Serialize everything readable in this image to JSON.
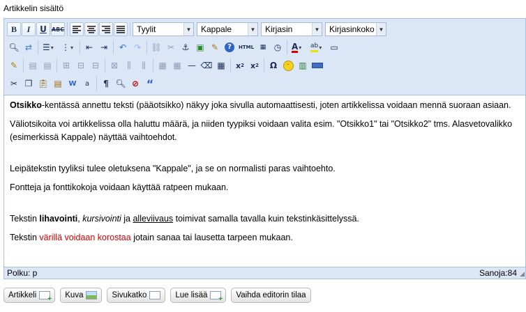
{
  "field_label": "Artikkelin sisältö",
  "toolbar": {
    "row1": {
      "buttons": [
        {
          "name": "bold-icon",
          "glyph": "B"
        },
        {
          "name": "italic-icon",
          "glyph": "I"
        },
        {
          "name": "underline-icon",
          "glyph": "U"
        },
        {
          "name": "strikethrough-icon",
          "glyph": "ABC"
        },
        {
          "name": "align-left-icon",
          "glyph": "≡"
        },
        {
          "name": "align-center-icon",
          "glyph": "≡"
        },
        {
          "name": "align-right-icon",
          "glyph": "≡"
        },
        {
          "name": "align-justify-icon",
          "glyph": "≡"
        }
      ],
      "dropdowns": {
        "styles": "Tyylit",
        "paragraph": "Kappale",
        "font": "Kirjasin",
        "font_size": "Kirjasinkoko"
      }
    },
    "row2_icons": [
      "find-icon",
      "replace-icon",
      "bullet-list-icon",
      "numbered-list-icon",
      "outdent-icon",
      "indent-icon",
      "undo-icon",
      "redo-icon",
      "link-icon",
      "unlink-icon",
      "anchor-icon",
      "image-icon",
      "cleanup-icon",
      "help-icon",
      "html-icon",
      "insert-date-icon",
      "insert-time-icon",
      "font-color-icon",
      "highlight-color-icon",
      "fullscreen-icon"
    ],
    "row3_icons": [
      "insert-table-icon",
      "table-props-icon",
      "cell-props-icon",
      "row-props-icon",
      "insert-row-before-icon",
      "insert-row-after-icon",
      "delete-row-icon",
      "col-before-icon",
      "col-after-icon",
      "delete-col-icon",
      "split-cells-icon",
      "merge-cells-icon",
      "horizontal-rule-icon",
      "eraser-icon",
      "visual-aid-icon",
      "subscript-icon",
      "superscript-icon",
      "special-char-icon",
      "emoticon-icon",
      "media-icon",
      "hr-advanced-icon"
    ],
    "row4_icons": [
      "cut-icon",
      "copy-icon",
      "paste-icon",
      "paste-text-icon",
      "paste-word-icon",
      "select-all-icon",
      "show-blocks-icon",
      "preview-icon",
      "remove-format-icon",
      "blockquote-icon"
    ]
  },
  "content": {
    "p1": {
      "bold": "Otsikko",
      "rest": "-kentässä annettu teksti (pääotsikko) näkyy joka sivulla automaattisesti, joten artikkelissa voidaan mennä suoraan asiaan."
    },
    "p2": "Väliotsikoita voi artikkelissa olla haluttu määrä, ja niiden tyypiksi voidaan valita esim. \"Otsikko1\" tai \"Otsikko2\" tms. Alasvetovalikko (esimerkissä Kappale) näyttää vaihtoehdot.",
    "p3": "Leipätekstin tyyliksi tulee oletuksena \"Kappale\", ja se on normalisti paras vaihtoehto.",
    "p4": "Fontteja ja fonttikokoja voidaan käyttää ratpeen mukaan.",
    "p5": {
      "start": "Tekstin ",
      "bold": "lihavointi",
      "comma": ", ",
      "italic": "kursivointi",
      "ja": " ja ",
      "underline": "alleviivaus",
      "end": " toimivat samalla tavalla kuin tekstinkäsittelyssä."
    },
    "p6": {
      "start": "Tekstin ",
      "red": "värillä voidaan korostaa",
      "end": " jotain sanaa tai lausetta tarpeen mukaan."
    },
    "red_color": "#d40000"
  },
  "status": {
    "path": "Polku: p",
    "word_count": "Sanoja:84"
  },
  "bottom_buttons": {
    "article": "Artikkeli",
    "image": "Kuva",
    "page_break": "Sivukatko",
    "read_more": "Lue lisää",
    "toggle_editor": "Vaihda editorin tilaa"
  }
}
